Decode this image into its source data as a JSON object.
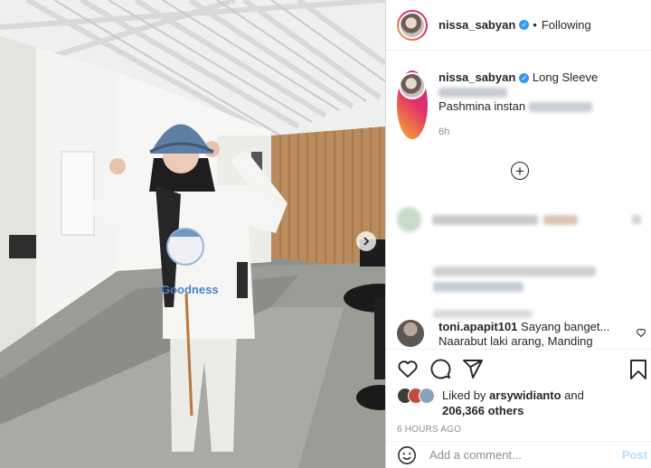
{
  "post": {
    "username": "nissa_sabyan",
    "follow_separator": "•",
    "follow_label": "Following"
  },
  "caption": {
    "username": "nissa_sabyan",
    "line1": "Long Sleeve",
    "line2": "Pashmina instan",
    "time": "6h"
  },
  "comment": {
    "username": "toni.apapit101",
    "text": "Sayang banget...",
    "text2": "Naarabut laki arang, Manding"
  },
  "likes": {
    "prefix": "Liked by ",
    "user": "arsywidianto",
    "middle": " and",
    "count": "206,366 others"
  },
  "timestamp": "6 HOURS AGO",
  "add_comment": {
    "placeholder": "Add a comment...",
    "post_label": "Post"
  },
  "illustration": {
    "shirt_print": "Goodness"
  },
  "icons": {
    "verified": "verified-badge-icon",
    "add": "plus-circle-icon",
    "like": "heart-icon",
    "comment": "comment-icon",
    "share": "paper-plane-icon",
    "save": "bookmark-icon",
    "emoji": "smiley-icon",
    "next": "chevron-right-icon"
  },
  "colors": {
    "verified": "#3897f0",
    "post_button": "#b2dffc",
    "muted_text": "#8e8e8e"
  }
}
